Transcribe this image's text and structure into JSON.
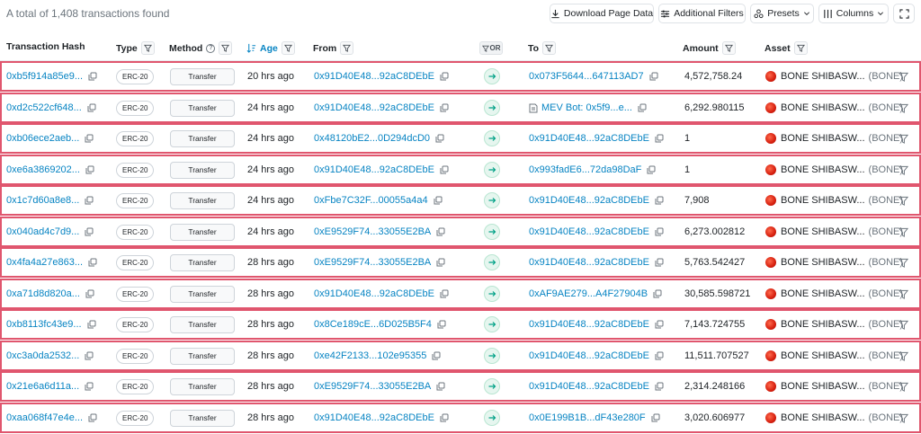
{
  "summary": "A total of 1,408 transactions found",
  "toolbar": {
    "download": "Download Page Data",
    "filters": "Additional Filters",
    "presets": "Presets",
    "columns": "Columns"
  },
  "columns": {
    "hash": "Transaction Hash",
    "type": "Type",
    "method": "Method",
    "age": "Age",
    "from": "From",
    "or": "OR",
    "to": "To",
    "amount": "Amount",
    "asset": "Asset"
  },
  "rows": [
    {
      "hash": "0xb5f914a85e9...",
      "type": "ERC-20",
      "method": "Transfer",
      "age": "20 hrs ago",
      "from": "0x91D40E48...92aC8DEbE",
      "to": "0x073F5644...647113AD7",
      "to_contract": false,
      "amount": "4,572,758.24",
      "asset": "BONE SHIBASW...",
      "symbol": "(BONE)"
    },
    {
      "hash": "0xd2c522cf648...",
      "type": "ERC-20",
      "method": "Transfer",
      "age": "24 hrs ago",
      "from": "0x91D40E48...92aC8DEbE",
      "to": "MEV Bot: 0x5f9...e...",
      "to_contract": true,
      "amount": "6,292.980115",
      "asset": "BONE SHIBASW...",
      "symbol": "(BONE)"
    },
    {
      "hash": "0xb06ece2aeb...",
      "type": "ERC-20",
      "method": "Transfer",
      "age": "24 hrs ago",
      "from": "0x48120bE2...0D294dcD0",
      "to": "0x91D40E48...92aC8DEbE",
      "to_contract": false,
      "amount": "1",
      "asset": "BONE SHIBASW...",
      "symbol": "(BONE)"
    },
    {
      "hash": "0xe6a3869202...",
      "type": "ERC-20",
      "method": "Transfer",
      "age": "24 hrs ago",
      "from": "0x91D40E48...92aC8DEbE",
      "to": "0x993fadE6...72da98DaF",
      "to_contract": false,
      "amount": "1",
      "asset": "BONE SHIBASW...",
      "symbol": "(BONE)"
    },
    {
      "hash": "0x1c7d60a8e8...",
      "type": "ERC-20",
      "method": "Transfer",
      "age": "24 hrs ago",
      "from": "0xFbe7C32F...00055a4a4",
      "to": "0x91D40E48...92aC8DEbE",
      "to_contract": false,
      "amount": "7,908",
      "asset": "BONE SHIBASW...",
      "symbol": "(BONE)"
    },
    {
      "hash": "0x040ad4c7d9...",
      "type": "ERC-20",
      "method": "Transfer",
      "age": "24 hrs ago",
      "from": "0xE9529F74...33055E2BA",
      "to": "0x91D40E48...92aC8DEbE",
      "to_contract": false,
      "amount": "6,273.002812",
      "asset": "BONE SHIBASW...",
      "symbol": "(BONE)"
    },
    {
      "hash": "0x4fa4a27e863...",
      "type": "ERC-20",
      "method": "Transfer",
      "age": "28 hrs ago",
      "from": "0xE9529F74...33055E2BA",
      "to": "0x91D40E48...92aC8DEbE",
      "to_contract": false,
      "amount": "5,763.542427",
      "asset": "BONE SHIBASW...",
      "symbol": "(BONE)"
    },
    {
      "hash": "0xa71d8d820a...",
      "type": "ERC-20",
      "method": "Transfer",
      "age": "28 hrs ago",
      "from": "0x91D40E48...92aC8DEbE",
      "to": "0xAF9AE279...A4F27904B",
      "to_contract": false,
      "amount": "30,585.598721",
      "asset": "BONE SHIBASW...",
      "symbol": "(BONE)"
    },
    {
      "hash": "0xb8113fc43e9...",
      "type": "ERC-20",
      "method": "Transfer",
      "age": "28 hrs ago",
      "from": "0x8Ce189cE...6D025B5F4",
      "to": "0x91D40E48...92aC8DEbE",
      "to_contract": false,
      "amount": "7,143.724755",
      "asset": "BONE SHIBASW...",
      "symbol": "(BONE)"
    },
    {
      "hash": "0xc3a0da2532...",
      "type": "ERC-20",
      "method": "Transfer",
      "age": "28 hrs ago",
      "from": "0xe42F2133...102e95355",
      "to": "0x91D40E48...92aC8DEbE",
      "to_contract": false,
      "amount": "11,511.707527",
      "asset": "BONE SHIBASW...",
      "symbol": "(BONE)"
    },
    {
      "hash": "0x21e6a6d11a...",
      "type": "ERC-20",
      "method": "Transfer",
      "age": "28 hrs ago",
      "from": "0xE9529F74...33055E2BA",
      "to": "0x91D40E48...92aC8DEbE",
      "to_contract": false,
      "amount": "2,314.248166",
      "asset": "BONE SHIBASW...",
      "symbol": "(BONE)"
    },
    {
      "hash": "0xaa068f47e4e...",
      "type": "ERC-20",
      "method": "Transfer",
      "age": "28 hrs ago",
      "from": "0x91D40E48...92aC8DEbE",
      "to": "0x0E199B1B...dF43e280F",
      "to_contract": false,
      "amount": "3,020.606977",
      "asset": "BONE SHIBASW...",
      "symbol": "(BONE)"
    }
  ],
  "colors": {
    "link": "#0784c3",
    "row_outline": "#e0566e",
    "transfer_arrow": "#00a186",
    "token_icon": "#d61f0e"
  },
  "icons": [
    "download-icon",
    "sliders-icon",
    "presets-icon",
    "chevron-down-icon",
    "columns-icon",
    "expand-icon",
    "filter-icon",
    "help-icon",
    "sort-icon",
    "copy-icon",
    "arrow-right-icon",
    "contract-icon",
    "token-icon"
  ]
}
